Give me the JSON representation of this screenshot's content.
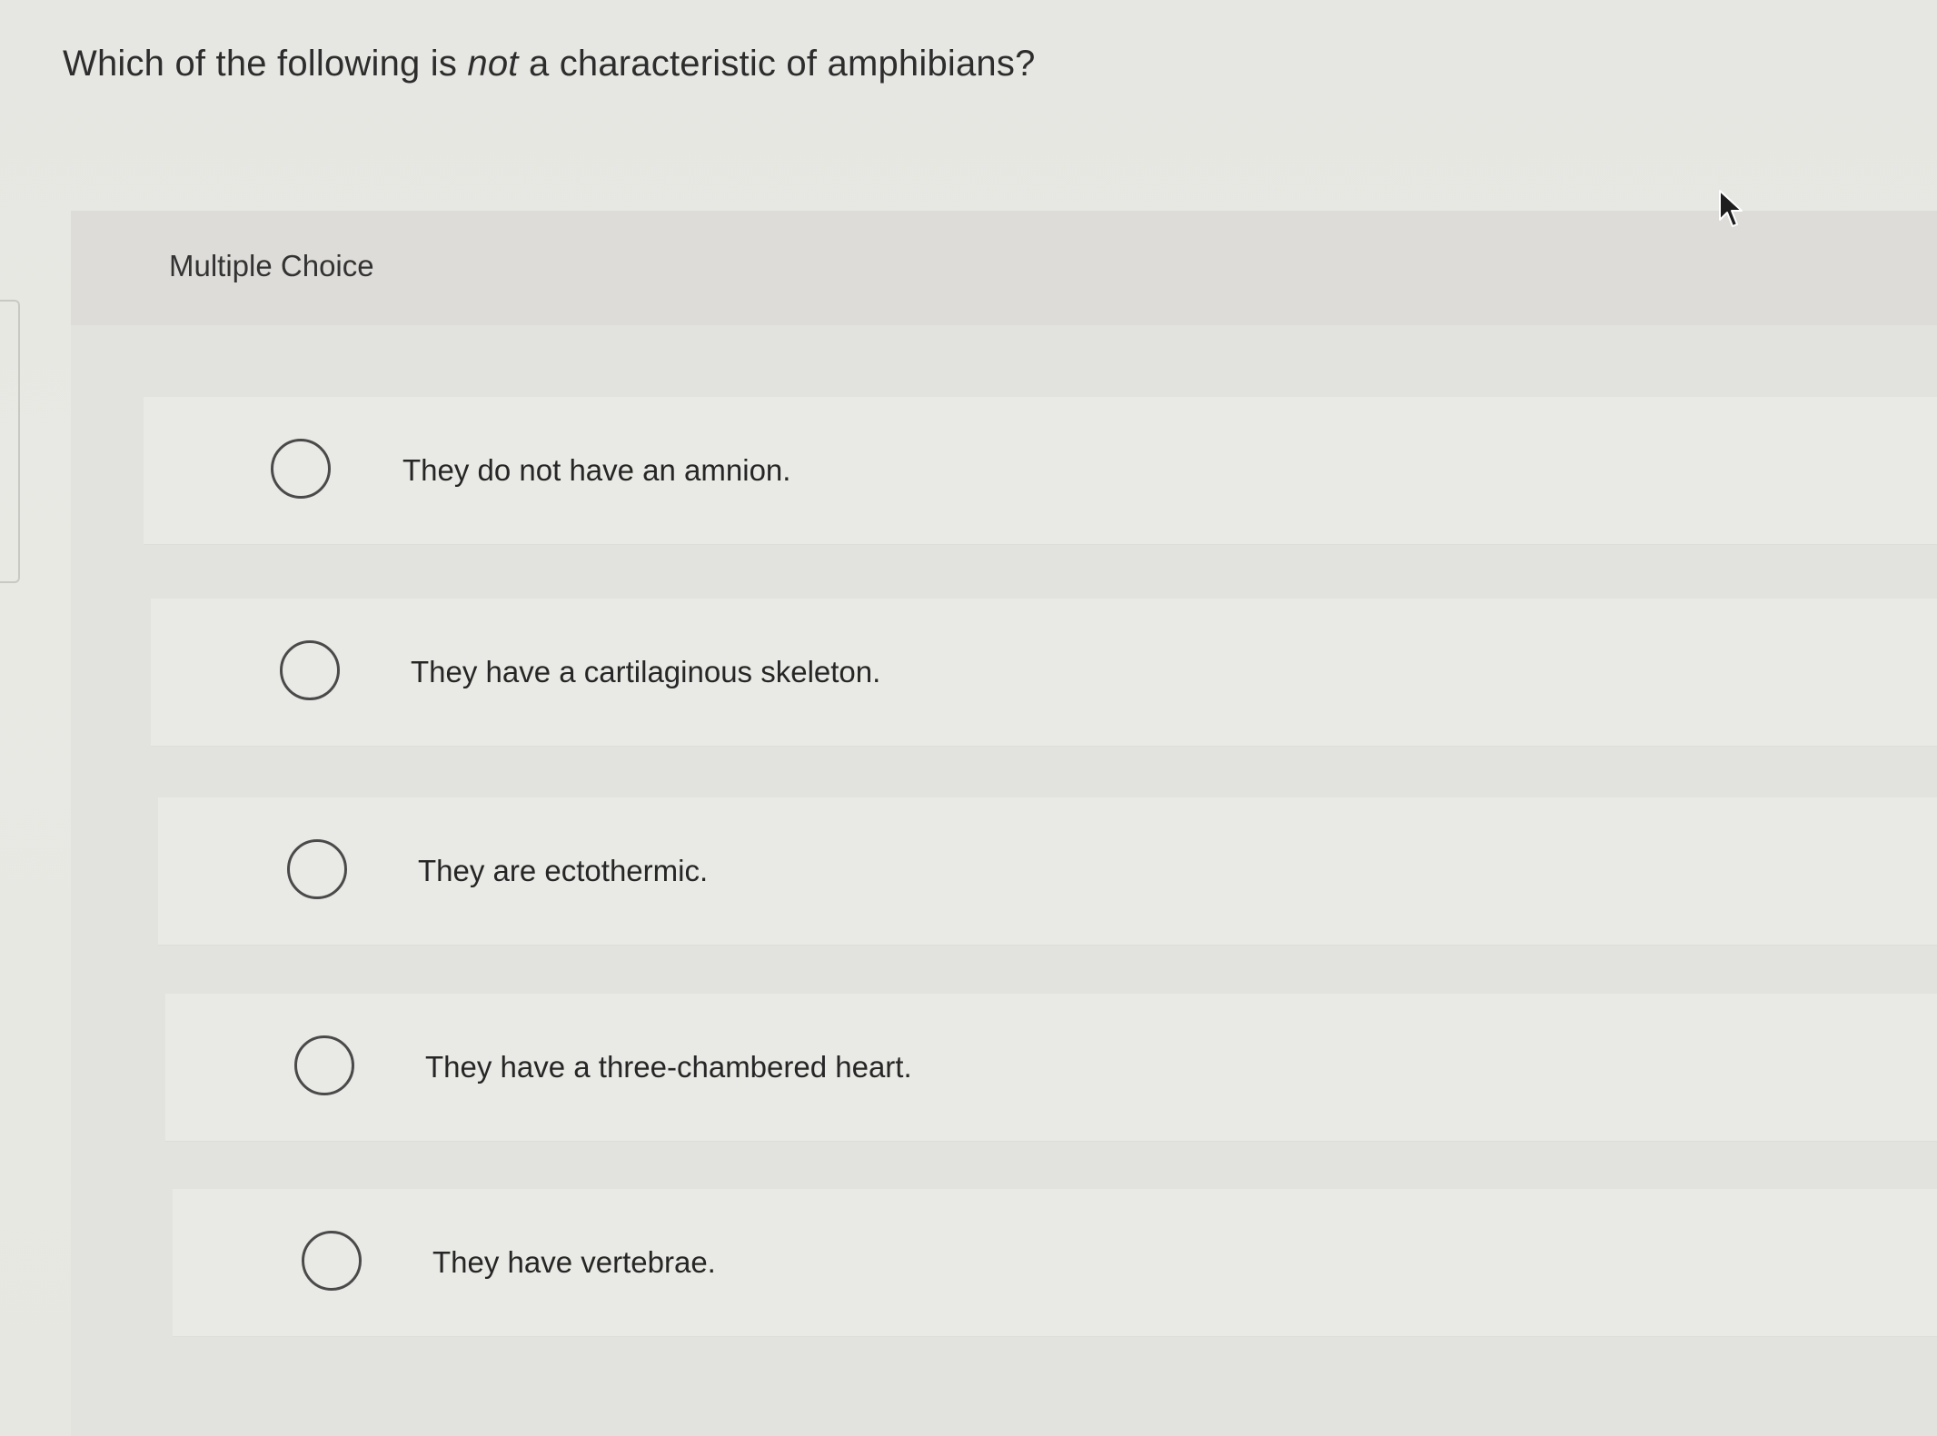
{
  "question": {
    "before": "Which of the following is ",
    "emphasis": "not",
    "after": " a characteristic of amphibians?"
  },
  "question_type": "Multiple Choice",
  "options": [
    {
      "label": "They do not have an amnion.",
      "selected": false
    },
    {
      "label": "They have a cartilaginous skeleton.",
      "selected": false
    },
    {
      "label": "They are ectothermic.",
      "selected": false
    },
    {
      "label": "They have a three-chambered heart.",
      "selected": false
    },
    {
      "label": "They have vertebrae.",
      "selected": false
    }
  ],
  "icons": {
    "radio": "radio-circle-icon",
    "cursor": "mouse-pointer-icon"
  },
  "colors": {
    "background": "#e6e6e2",
    "panel": "#e2e2de",
    "option_card": "#e9e9e5",
    "text": "#2d2d2d",
    "radio_border": "#4a4a4a"
  }
}
